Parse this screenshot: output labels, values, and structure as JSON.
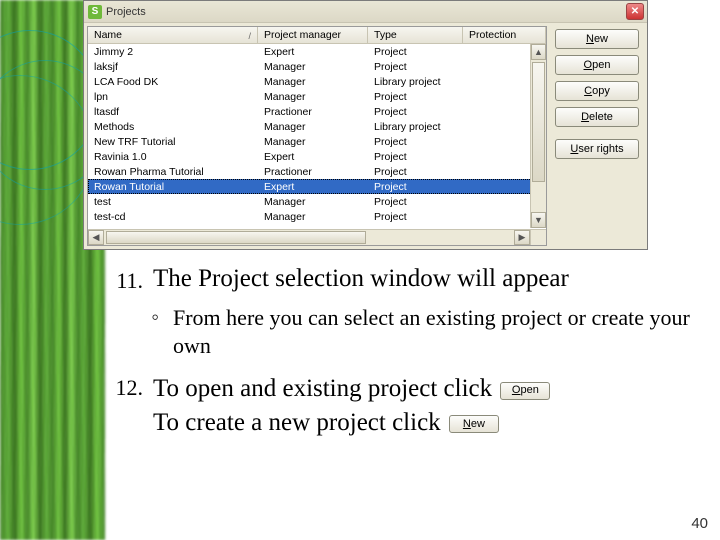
{
  "dialog": {
    "title": "Projects",
    "app_icon_letter": "S",
    "columns": {
      "name": "Name",
      "pm": "Project manager",
      "type": "Type",
      "prot": "Protection"
    },
    "rows": [
      {
        "name": "Jimmy 2",
        "pm": "Expert",
        "type": "Project",
        "prot": ""
      },
      {
        "name": "laksjf",
        "pm": "Manager",
        "type": "Project",
        "prot": ""
      },
      {
        "name": "LCA Food DK",
        "pm": "Manager",
        "type": "Library project",
        "prot": ""
      },
      {
        "name": "lpn",
        "pm": "Manager",
        "type": "Project",
        "prot": ""
      },
      {
        "name": "ltasdf",
        "pm": "Practioner",
        "type": "Project",
        "prot": ""
      },
      {
        "name": "Methods",
        "pm": "Manager",
        "type": "Library project",
        "prot": ""
      },
      {
        "name": "New TRF Tutorial",
        "pm": "Manager",
        "type": "Project",
        "prot": ""
      },
      {
        "name": "Ravinia 1.0",
        "pm": "Expert",
        "type": "Project",
        "prot": ""
      },
      {
        "name": "Rowan Pharma Tutorial",
        "pm": "Practioner",
        "type": "Project",
        "prot": ""
      },
      {
        "name": "Rowan Tutorial",
        "pm": "Expert",
        "type": "Project",
        "prot": "",
        "selected": true
      },
      {
        "name": "test",
        "pm": "Manager",
        "type": "Project",
        "prot": ""
      },
      {
        "name": "test-cd",
        "pm": "Manager",
        "type": "Project",
        "prot": ""
      }
    ],
    "buttons": {
      "new_prefix": "N",
      "new_rest": "ew",
      "open_prefix": "O",
      "open_rest": "pen",
      "copy_prefix": "C",
      "copy_rest": "opy",
      "delete_prefix": "D",
      "delete_rest": "elete",
      "userrights_prefix": "U",
      "userrights_rest": "ser rights"
    }
  },
  "text": {
    "li11_num": "11.",
    "li11_body": "The Project selection window will appear",
    "sub_bullet": "◦",
    "sub_body": "From here you can select an existing project or create your own",
    "li12_num": "12.",
    "li12_line1_a": "To open and existing project click",
    "li12_line2_a": "To create a new project click",
    "inline_open_prefix": "O",
    "inline_open_rest": "pen",
    "inline_new_prefix": "N",
    "inline_new_rest": "ew"
  },
  "page_number": "40"
}
